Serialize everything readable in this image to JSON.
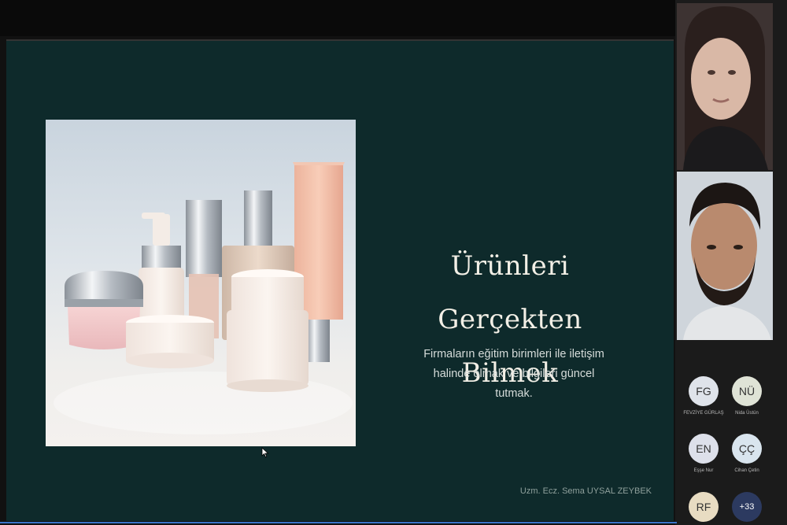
{
  "slide": {
    "title_line1": "Ürünleri Gerçekten",
    "title_line2": "Bilmek",
    "body_line1": "Firmaların eğitim birimleri ile iletişim",
    "body_line2": "halinde olmak ve bilgileri güncel",
    "body_line3": "tutmak.",
    "footer": "Uzm. Ecz. Sema UYSAL ZEYBEK"
  },
  "participants": [
    {
      "initials": "FG",
      "name": "FEVZİYE GÜRLAŞ",
      "color": "#dfe3ea"
    },
    {
      "initials": "NÜ",
      "name": "Nida Üstün",
      "color": "#dfe3d6"
    },
    {
      "initials": "EN",
      "name": "Eşşe Nur",
      "color": "#dde0ea"
    },
    {
      "initials": "ÇÇ",
      "name": "Cihan Çetin",
      "color": "#d9e5ee"
    },
    {
      "initials": "RF",
      "name": "",
      "color": "#e8dcc2"
    }
  ],
  "more_participants": "+33",
  "colors": {
    "slide_bg": "#0e2a2b",
    "panel_bg": "#1b1b1b",
    "more_badge": "#2c3a60"
  },
  "icons": {
    "cursor": "mouse-pointer-icon"
  }
}
